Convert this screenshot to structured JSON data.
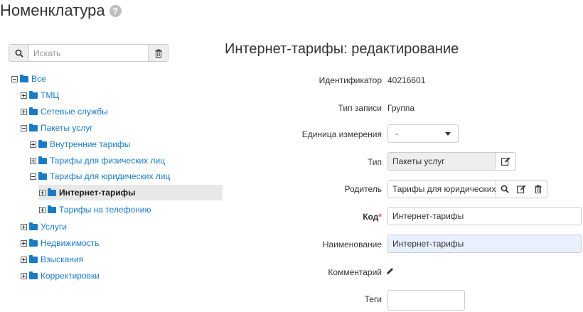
{
  "header": {
    "title": "Номенклатура",
    "help_icon": "?"
  },
  "search": {
    "placeholder": "Искать"
  },
  "tree": {
    "nodes": [
      {
        "label": "Все",
        "expander": "minus"
      },
      {
        "label": "ТМЦ",
        "expander": "plus"
      },
      {
        "label": "Сетевые службы",
        "expander": "plus"
      },
      {
        "label": "Пакеты услуг",
        "expander": "minus"
      },
      {
        "label": "Внутренние тарифы",
        "expander": "plus"
      },
      {
        "label": "Тарифы для физических лиц",
        "expander": "plus"
      },
      {
        "label": "Тарифы для юридических лиц",
        "expander": "minus"
      },
      {
        "label": "Интернет-тарифы",
        "expander": "plus",
        "selected": true
      },
      {
        "label": "Тарифы на телефонию",
        "expander": "plus"
      },
      {
        "label": "Услуги",
        "expander": "plus"
      },
      {
        "label": "Недвижимость",
        "expander": "plus"
      },
      {
        "label": "Взыскания",
        "expander": "plus"
      },
      {
        "label": "Корректировки",
        "expander": "plus"
      }
    ]
  },
  "form": {
    "title": "Интернет-тарифы: редактирование",
    "id_label": "Идентификатор",
    "id_value": "40216601",
    "record_type_label": "Тип записи",
    "record_type_value": "Группа",
    "unit_label": "Единица измерения",
    "unit_value": "-",
    "type_label": "Тип",
    "type_value": "Пакеты услуг",
    "parent_label": "Родитель",
    "parent_value": "Тарифы для юридических лиц",
    "code_label": "Код",
    "code_required": "*",
    "code_value": "Интернет-тарифы",
    "name_label": "Наименование",
    "name_value": "Интернет-тарифы",
    "comment_label": "Комментарий",
    "tags_label": "Теги",
    "tags_value": ""
  },
  "colors": {
    "link": "#1a7bc4",
    "required": "#d9534f",
    "selected_row": "#e8e8e8"
  }
}
